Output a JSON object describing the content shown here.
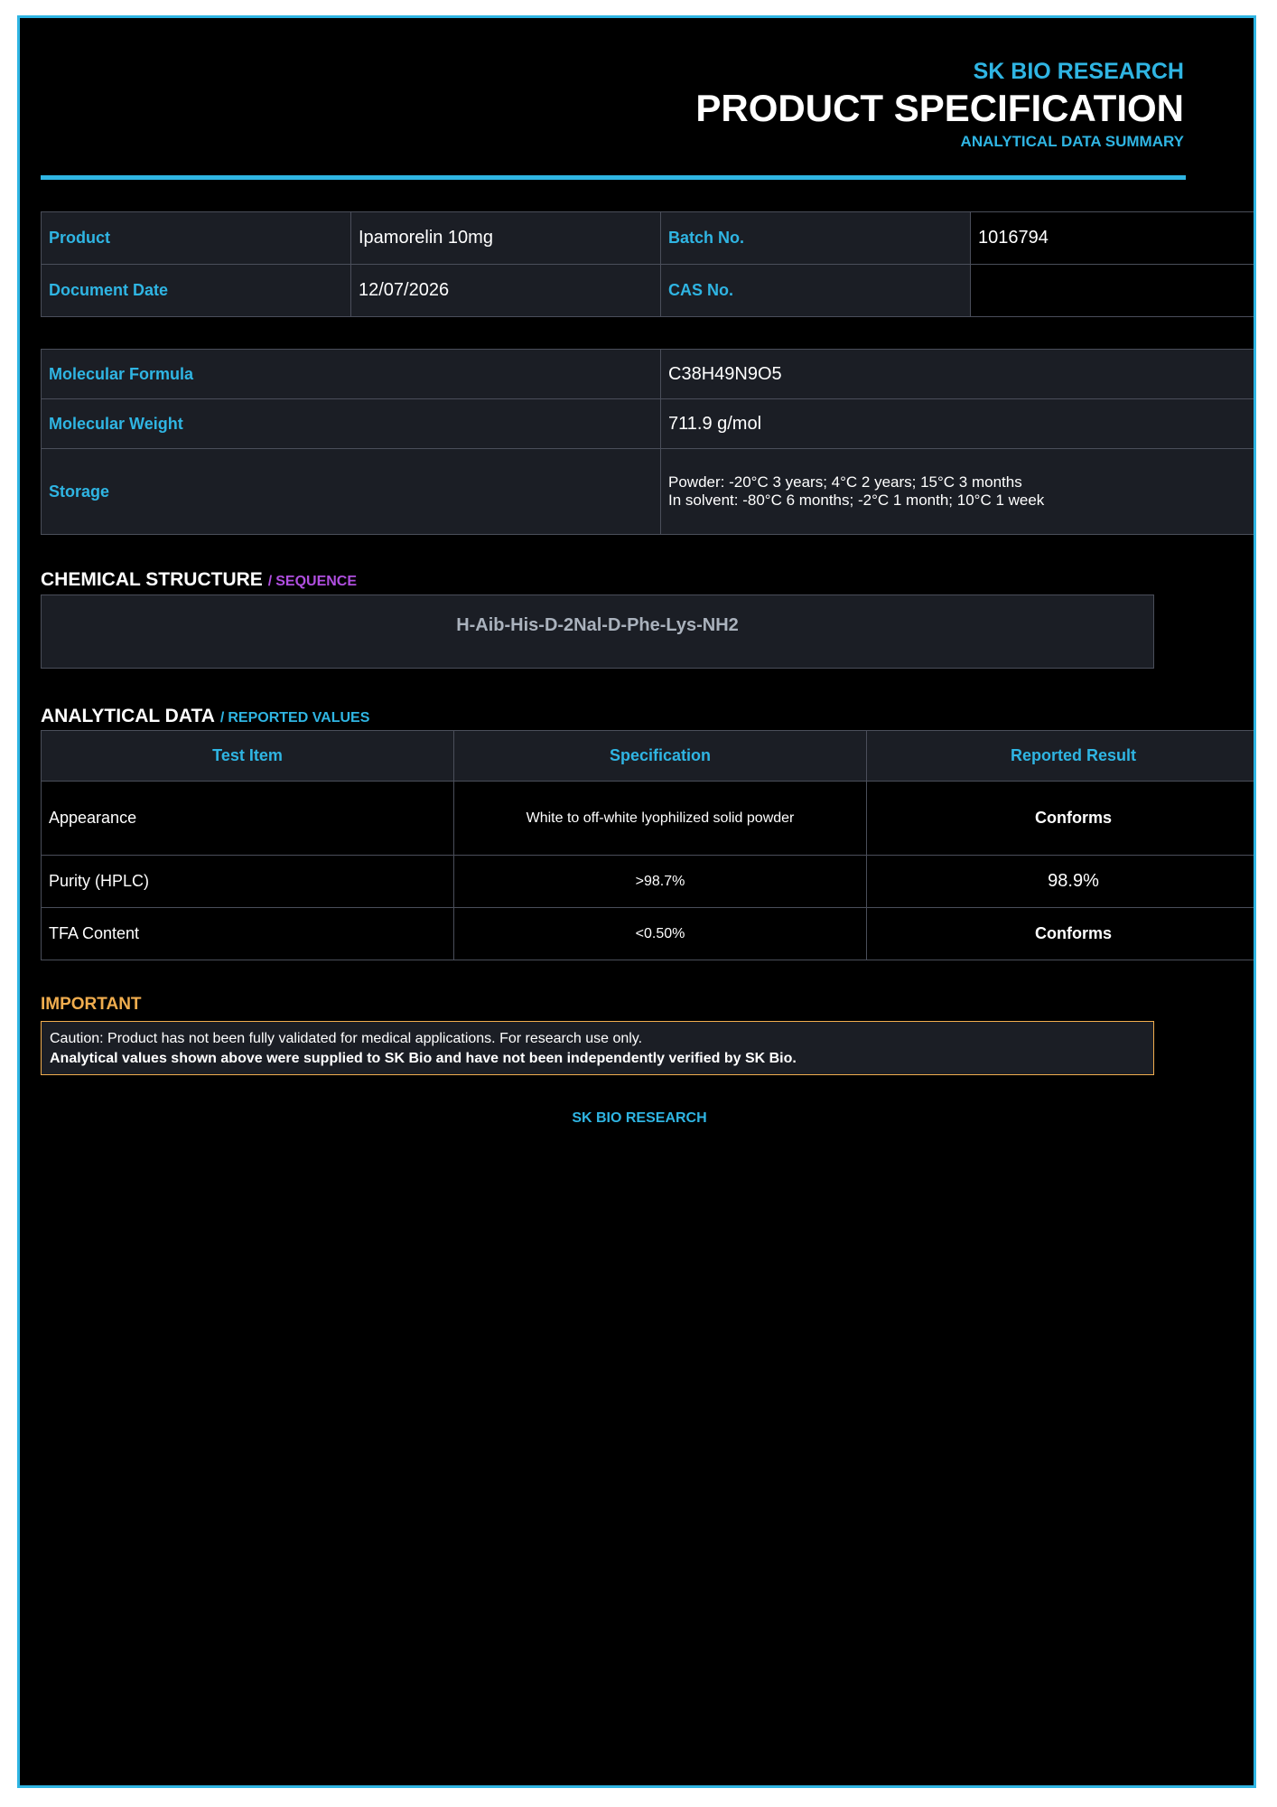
{
  "header": {
    "brand": "SK BIO RESEARCH",
    "title": "PRODUCT SPECIFICATION",
    "subtitle": "ANALYTICAL DATA SUMMARY"
  },
  "info_table": {
    "product_label": "Product",
    "product_value": "Ipamorelin 10mg",
    "batch_label": "Batch No.",
    "batch_value": "1016794",
    "date_label": "Document Date",
    "date_value": "12/07/2026",
    "cas_label": "CAS No.",
    "cas_value": ""
  },
  "properties": {
    "formula_label": "Molecular Formula",
    "formula_value": "C38H49N9O5",
    "weight_label": "Molecular Weight",
    "weight_value": "711.9 g/mol",
    "storage_label": "Storage",
    "storage_line1": "Powder: -20°C 3 years; 4°C 2 years; 15°C 3 months",
    "storage_line2": "In solvent: -80°C 6 months; -2°C 1 month; 10°C 1 week"
  },
  "structure": {
    "heading": "CHEMICAL STRUCTURE",
    "slash": "/",
    "subheading": "SEQUENCE",
    "sequence": "H-Aib-His-D-2Nal-D-Phe-Lys-NH2"
  },
  "analytical": {
    "heading": "ANALYTICAL DATA",
    "slash": "/",
    "subheading": "REPORTED VALUES",
    "columns": [
      "Test Item",
      "Specification",
      "Reported Result"
    ],
    "rows": [
      {
        "item": "Appearance",
        "spec": "White to off-white lyophilized solid powder",
        "result": "Conforms"
      },
      {
        "item": "Purity (HPLC)",
        "spec": ">98.7%",
        "result": "98.9%"
      },
      {
        "item": "TFA Content",
        "spec": "<0.50%",
        "result": "Conforms"
      }
    ]
  },
  "important": {
    "title": "IMPORTANT",
    "line1": "Caution: Product has not been fully validated for medical applications. For research use only.",
    "line2": "Analytical values shown above were supplied to SK Bio and have not been independently verified by SK Bio."
  },
  "footer": {
    "text": "SK BIO RESEARCH"
  },
  "colors": {
    "accent": "#2fb5e3",
    "purple": "#b04fe0",
    "warning": "#f0ad4e",
    "background": "#000000",
    "panel": "#1b1e25"
  }
}
